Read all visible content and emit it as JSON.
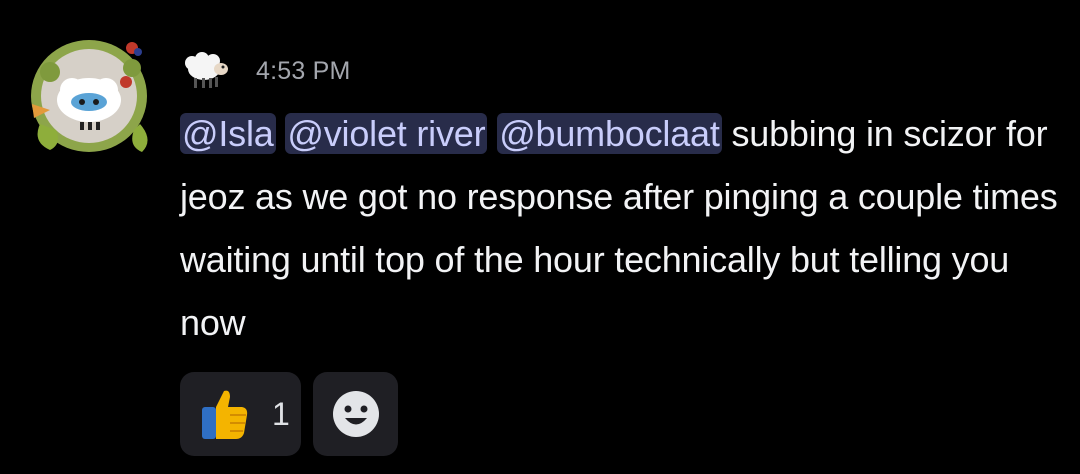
{
  "message": {
    "timestamp": "4:53 PM",
    "author_icon": "sheep-emoji-icon",
    "mentions": [
      "@Isla",
      "@violet river",
      "@bumboclaat"
    ],
    "text": "subbing in scizor for jeoz as we got no response after pinging a couple times waiting until top of the hour technically but telling you now"
  },
  "reactions": [
    {
      "emoji": "thumbs-up-icon",
      "count": "1"
    }
  ],
  "add_reaction_icon": "smiley-add-reaction-icon",
  "colors": {
    "background": "#000000",
    "mention_bg": "#282c4a",
    "mention_text": "#c9cdfb",
    "reaction_bg": "#1f1f24",
    "timestamp": "#a3a6ad"
  }
}
